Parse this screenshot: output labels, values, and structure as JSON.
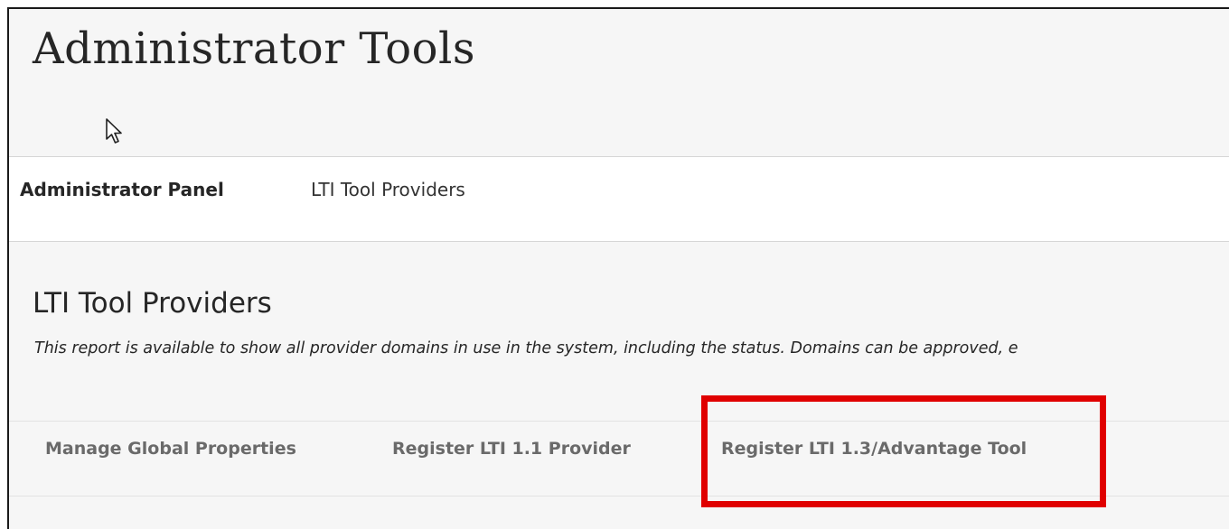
{
  "page": {
    "title": "Administrator Tools"
  },
  "breadcrumb": {
    "items": [
      {
        "label": "Administrator Panel"
      },
      {
        "label": "LTI Tool Providers"
      }
    ]
  },
  "section": {
    "title": "LTI Tool Providers",
    "description": "This report is available to show all provider domains in use in the system, including the status. Domains can be approved, e"
  },
  "actions": [
    {
      "label": "Manage Global Properties"
    },
    {
      "label": "Register LTI 1.1 Provider"
    },
    {
      "label": "Register LTI 1.3/Advantage Tool"
    }
  ],
  "colors": {
    "highlight": "#e00000",
    "background": "#f6f6f6",
    "action_text": "#6a6a6a"
  },
  "icons": {
    "cursor": "mouse-pointer-icon"
  }
}
